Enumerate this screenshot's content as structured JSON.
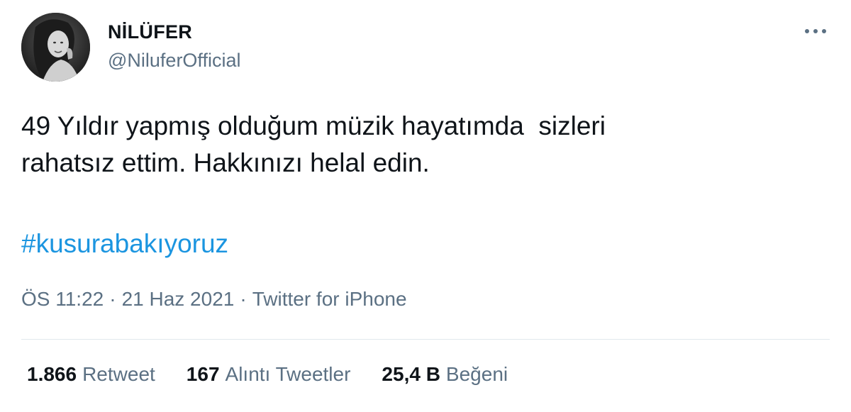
{
  "user": {
    "display_name": "NİLÜFER",
    "username": "@NiluferOfficial"
  },
  "more_icon": "more-dots-icon",
  "tweet": {
    "text": "49 Yıldır yapmış olduğum müzik hayatımda  sizleri\nrahatsız ettim. Hakkınızı helal edin.",
    "hashtag": "#kusurabakıyoruz"
  },
  "meta": {
    "time": "ÖS 11:22",
    "separator": "·",
    "date": "21 Haz 2021",
    "source": "Twitter for iPhone"
  },
  "stats": [
    {
      "count": "1.866",
      "label": "Retweet"
    },
    {
      "count": "167",
      "label": "Alıntı Tweetler"
    },
    {
      "count": "25,4 B",
      "label": "Beğeni"
    }
  ],
  "colors": {
    "link": "#1b95e0",
    "secondary_text": "#5b7083",
    "primary_text": "#0f1419"
  }
}
